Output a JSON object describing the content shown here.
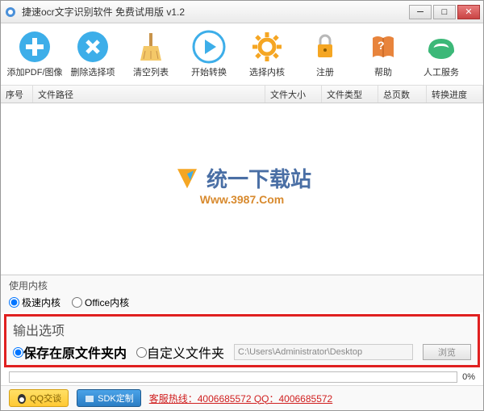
{
  "window": {
    "title": "捷速ocr文字识别软件 免费试用版 v1.2"
  },
  "toolbar": [
    {
      "label": "添加PDF/图像"
    },
    {
      "label": "删除选择项"
    },
    {
      "label": "清空列表"
    },
    {
      "label": "开始转换"
    },
    {
      "label": "选择内核"
    },
    {
      "label": "注册"
    },
    {
      "label": "帮助"
    },
    {
      "label": "人工服务"
    }
  ],
  "columns": [
    "序号",
    "文件路径",
    "文件大小",
    "文件类型",
    "总页数",
    "转换进度"
  ],
  "watermark": {
    "name": "统一下载站",
    "url": "Www.3987.Com"
  },
  "kernel": {
    "title": "使用内核",
    "opt1": "极速内核",
    "opt2": "Office内核"
  },
  "output": {
    "title": "输出选项",
    "opt1": "保存在原文件夹内",
    "opt2": "自定义文件夹",
    "path": "C:\\Users\\Administrator\\Desktop",
    "browse": "浏览"
  },
  "progress": {
    "percent": "0%"
  },
  "footer": {
    "qq": "QQ交谈",
    "sdk": "SDK定制",
    "hotline": "客服热线：4006685572 QQ：4006685572"
  }
}
